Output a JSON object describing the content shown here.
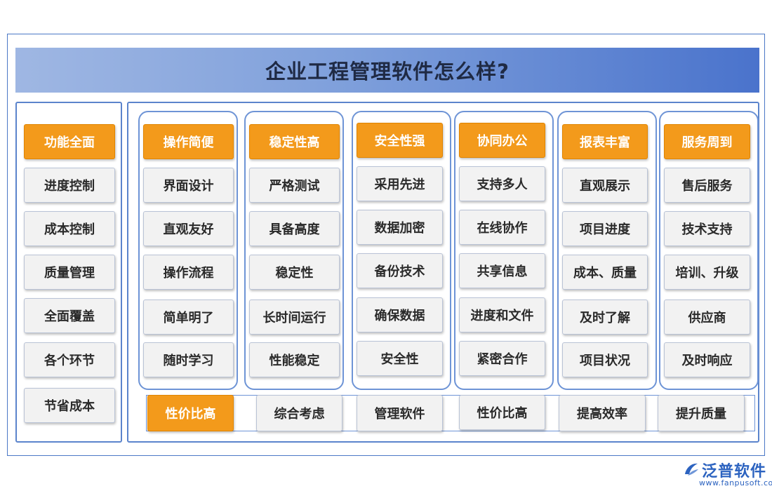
{
  "title": "企业工程管理软件怎么样?",
  "left_items": [
    "功能全面",
    "进度控制",
    "成本控制",
    "质量管理",
    "全面覆盖",
    "各个环节",
    "节省成本"
  ],
  "columns": [
    {
      "header": "操作简便",
      "items": [
        "界面设计",
        "直观友好",
        "操作流程",
        "简单明了",
        "随时学习"
      ]
    },
    {
      "header": "稳定性高",
      "items": [
        "严格测试",
        "具备高度",
        "稳定性",
        "长时间运行",
        "性能稳定"
      ]
    },
    {
      "header": "安全性强",
      "items": [
        "采用先进",
        "数据加密",
        "备份技术",
        "确保数据",
        "安全性"
      ]
    },
    {
      "header": "协同办公",
      "items": [
        "支持多人",
        "在线协作",
        "共享信息",
        "进度和文件",
        "紧密合作"
      ]
    },
    {
      "header": "报表丰富",
      "items": [
        "直观展示",
        "项目进度",
        "成本、质量",
        "及时了解",
        "项目状况"
      ]
    },
    {
      "header": "服务周到",
      "items": [
        "售后服务",
        "技术支持",
        "培训、升级",
        "供应商",
        "及时响应"
      ]
    }
  ],
  "bottom_items": [
    "性价比高",
    "综合考虑",
    "管理软件",
    "性价比高",
    "提高效率",
    "提升质量"
  ],
  "logo": {
    "name": "泛普软件",
    "url": "www.fanpusoft.com"
  },
  "colors": {
    "accent": "#f39a1b",
    "border": "#5b84cc",
    "box": "#f2f2f2",
    "brand": "#2c63c0"
  }
}
